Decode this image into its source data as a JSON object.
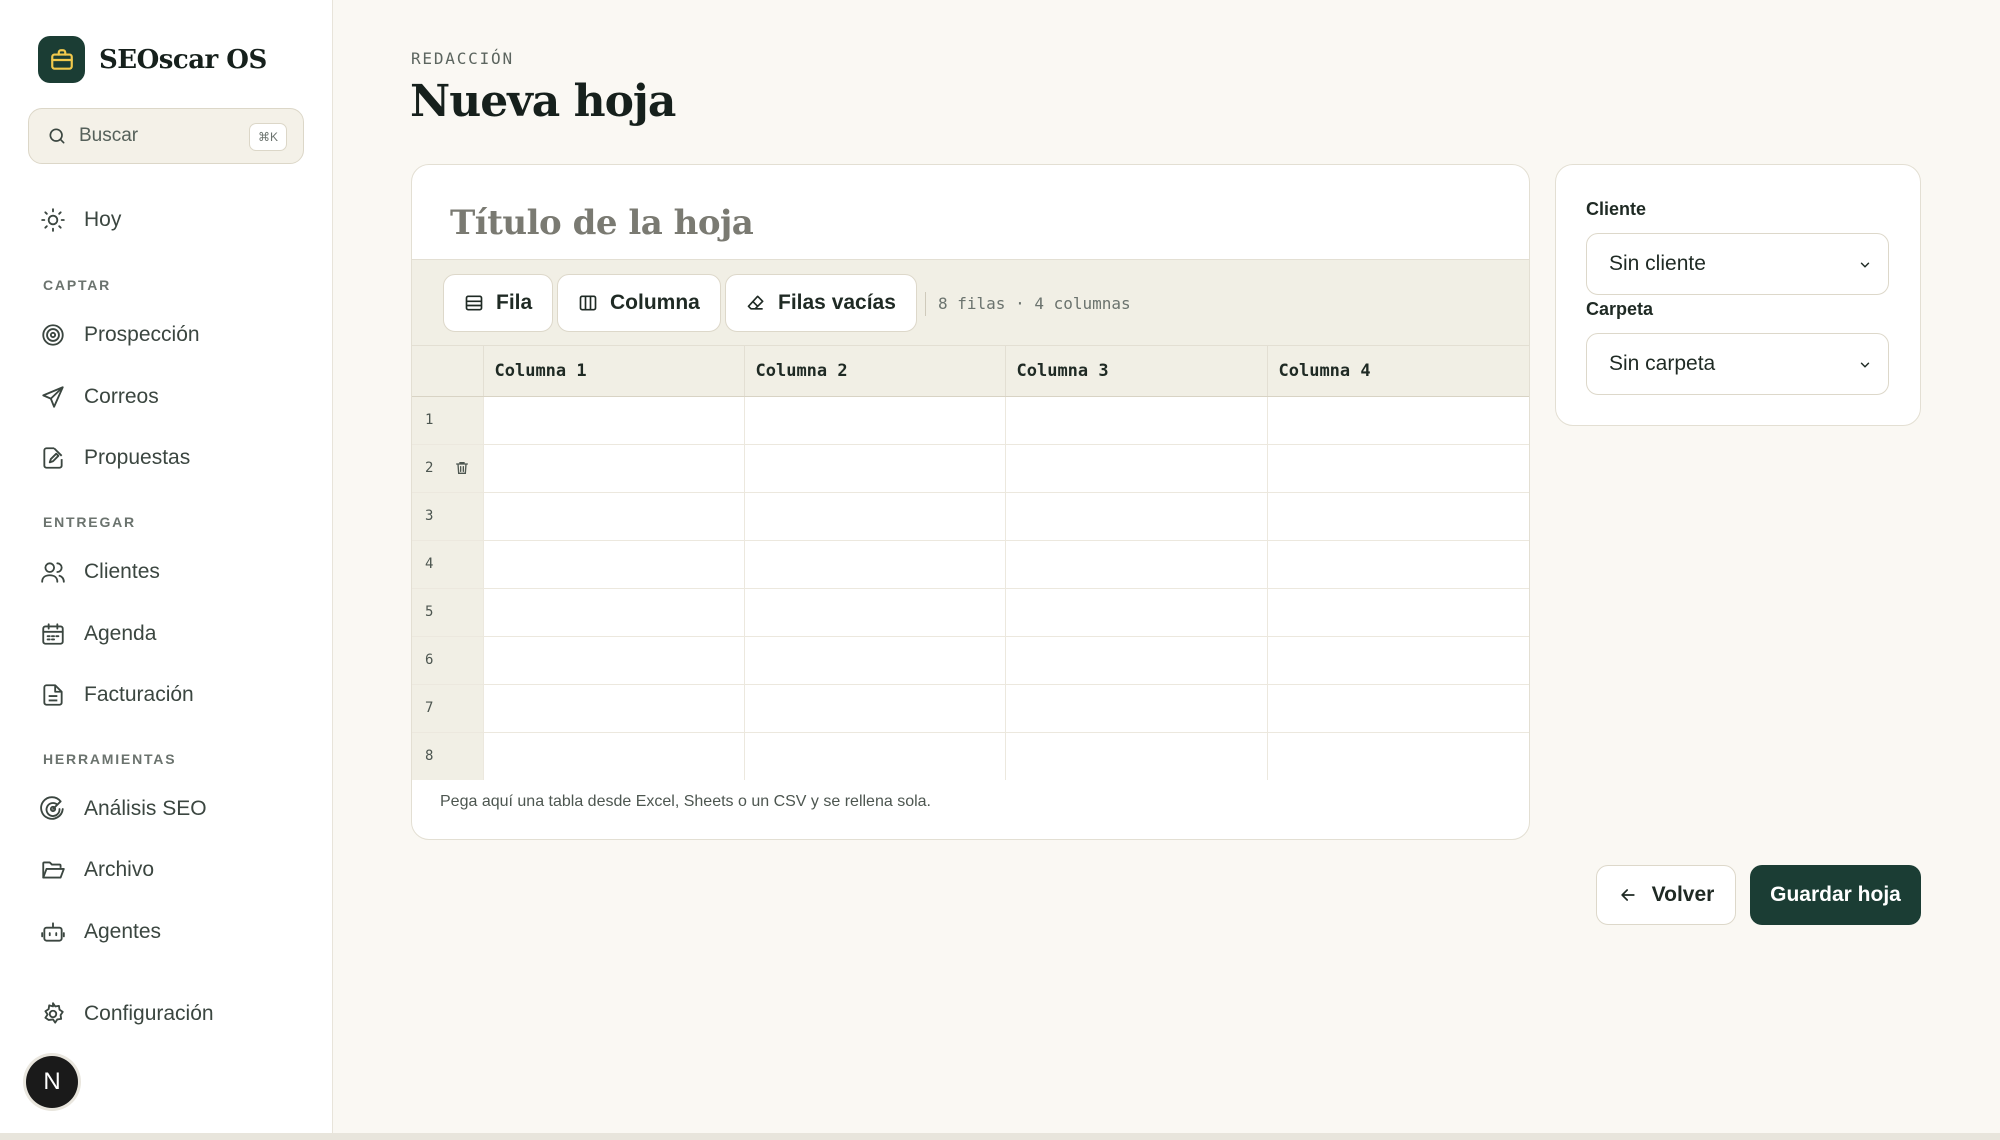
{
  "app": {
    "name": "SEOscar OS"
  },
  "search": {
    "label": "Buscar",
    "shortcut": "⌘K"
  },
  "sidebar": {
    "top_item": {
      "label": "Hoy",
      "icon": "sun-icon"
    },
    "sections": [
      {
        "title": "CAPTAR",
        "items": [
          {
            "label": "Prospección",
            "icon": "target-icon"
          },
          {
            "label": "Correos",
            "icon": "send-icon"
          },
          {
            "label": "Propuestas",
            "icon": "file-edit-icon"
          }
        ]
      },
      {
        "title": "ENTREGAR",
        "items": [
          {
            "label": "Clientes",
            "icon": "users-icon"
          },
          {
            "label": "Agenda",
            "icon": "calendar-icon"
          },
          {
            "label": "Facturación",
            "icon": "file-text-icon"
          }
        ]
      },
      {
        "title": "HERRAMIENTAS",
        "items": [
          {
            "label": "Análisis SEO",
            "icon": "radar-icon"
          },
          {
            "label": "Archivo",
            "icon": "folder-open-icon"
          },
          {
            "label": "Agentes",
            "icon": "bot-icon"
          }
        ]
      }
    ],
    "settings": {
      "label": "Configuración",
      "icon": "gear-icon"
    },
    "avatar": {
      "initial": "N"
    }
  },
  "page": {
    "eyebrow": "REDACCIÓN",
    "title": "Nueva hoja"
  },
  "sheet": {
    "title_placeholder": "Título de la hoja",
    "toolbar": {
      "add_row": "Fila",
      "add_column": "Columna",
      "clear_empty": "Filas vacías",
      "count": "8 filas · 4 columnas"
    },
    "columns": [
      "Columna 1",
      "Columna 2",
      "Columna 3",
      "Columna 4"
    ],
    "rows": [
      "1",
      "2",
      "3",
      "4",
      "5",
      "6",
      "7",
      "8"
    ],
    "hint": "Pega aquí una tabla desde Excel, Sheets o un CSV y se rellena sola."
  },
  "meta": {
    "client_label": "Cliente",
    "client_value": "Sin cliente",
    "folder_label": "Carpeta",
    "folder_value": "Sin carpeta"
  },
  "actions": {
    "back": "Volver",
    "save": "Guardar hoja"
  },
  "colors": {
    "brand": "#1b3d34",
    "background": "#faf8f3",
    "accent_icon": "#f2c94c"
  }
}
